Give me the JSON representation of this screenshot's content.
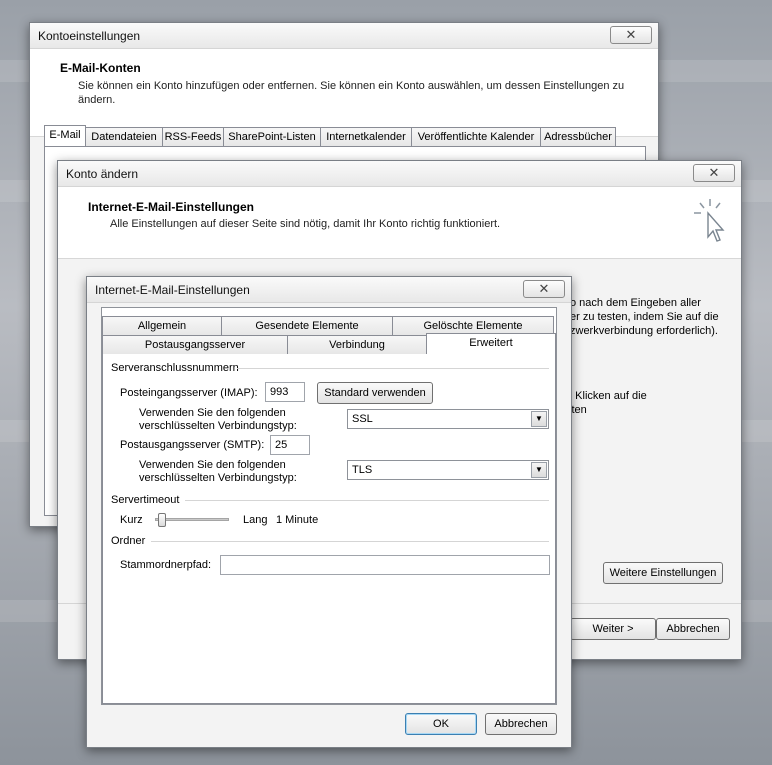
{
  "account_settings": {
    "title": "Kontoeinstellungen",
    "header_title": "E-Mail-Konten",
    "header_sub_line1": "Sie können ein Konto hinzufügen oder entfernen. Sie können ein Konto auswählen, um dessen Einstellungen zu",
    "header_sub_line2": "ändern.",
    "tabs": [
      "E-Mail",
      "Datendateien",
      "RSS-Feeds",
      "SharePoint-Listen",
      "Internetkalender",
      "Veröffentlichte Kalender",
      "Adressbücher"
    ]
  },
  "change_account": {
    "title": "Konto ändern",
    "header_title": "Internet-E-Mail-Einstellungen",
    "header_sub": "Alle Einstellungen auf dieser Seite sind nötig, damit Ihr Konto richtig funktioniert.",
    "right_text_line1": "o nach dem Eingeben aller",
    "right_text_line2": "er zu testen, indem Sie auf die",
    "right_text_line3": "zwerkverbindung erforderlich).",
    "right_text_line4": "h Klicken auf die",
    "right_text_line5": "sten",
    "more_settings_label": "Weitere Einstellungen",
    "next_label": "Weiter >",
    "cancel_label": "Abbrechen"
  },
  "internet_settings": {
    "title": "Internet-E-Mail-Einstellungen",
    "tabs_row1": [
      "Allgemein",
      "Gesendete Elemente",
      "Gelöschte Elemente"
    ],
    "tabs_row2": [
      "Postausgangsserver",
      "Verbindung",
      "Erweitert"
    ],
    "server_ports_group": "Serveranschlussnummern",
    "incoming_label": "Posteingangsserver (IMAP):",
    "incoming_value": "993",
    "use_default_label": "Standard verwenden",
    "encryption_label_line1": "Verwenden Sie den folgenden",
    "encryption_label_line2": "verschlüsselten Verbindungstyp:",
    "incoming_encryption": "SSL",
    "outgoing_label": "Postausgangsserver (SMTP):",
    "outgoing_value": "25",
    "outgoing_encryption": "TLS",
    "timeout_group": "Servertimeout",
    "timeout_short": "Kurz",
    "timeout_long": "Lang",
    "timeout_value": "1 Minute",
    "timeout_level": 0.05,
    "folders_group": "Ordner",
    "root_folder_label": "Stammordnerpfad:",
    "root_folder_value": "",
    "ok_label": "OK",
    "cancel_label": "Abbrechen"
  }
}
